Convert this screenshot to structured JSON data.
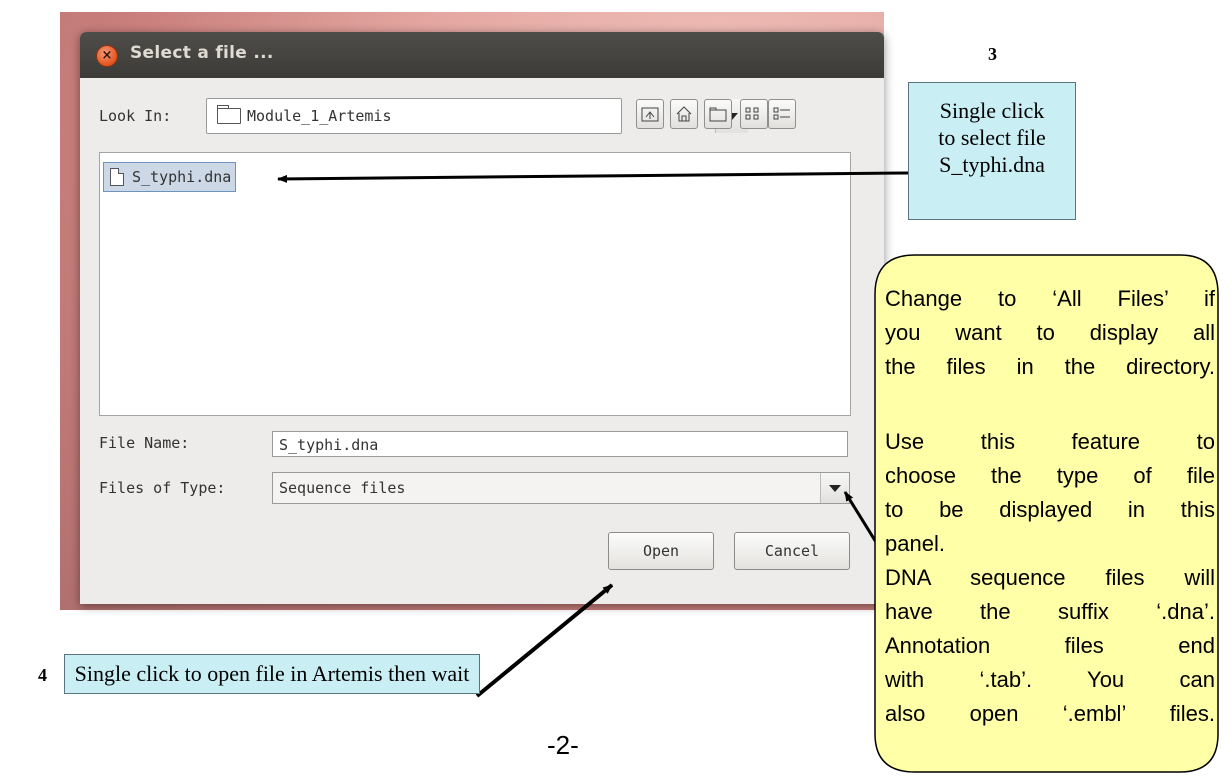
{
  "dialog": {
    "title": "Select a file ...",
    "close_symbol": "×",
    "look_in_label": "Look In:",
    "look_in_value": "Module_1_Artemis",
    "toolbar_icons": [
      "up-folder-icon",
      "home-icon",
      "new-folder-icon",
      "list-view-icon",
      "details-view-icon"
    ],
    "files": [
      {
        "name": "S_typhi.dna",
        "selected": true
      }
    ],
    "file_name_label": "File Name:",
    "file_name_value": "S_typhi.dna",
    "files_of_type_label": "Files of Type:",
    "files_of_type_value": "Sequence files",
    "open_label": "Open",
    "cancel_label": "Cancel"
  },
  "annotations": {
    "step3_number": "3",
    "step3_lines": [
      "Single click",
      "to select file",
      "S_typhi.dna"
    ],
    "step4_number": "4",
    "step4_text": "Single click to open file in Artemis then wait",
    "note_lines": [
      "Change to ‘All Files’ if",
      "you want to display all",
      "the files in the directory.",
      "",
      "Use this feature to",
      "choose the type of file",
      "to be displayed in this",
      "panel.",
      "DNA sequence files will",
      "have the suffix ‘.dna’.",
      "Annotation files end",
      "with ‘.tab’. You can",
      "also open ‘.embl’ files."
    ]
  },
  "page_number": "-2-",
  "colors": {
    "callout_fill": "#c9eef3",
    "note_fill": "#ffffa8",
    "titlebar": "#3c3b37",
    "close_button": "#e2531c",
    "selection": "#ccd8e6"
  }
}
